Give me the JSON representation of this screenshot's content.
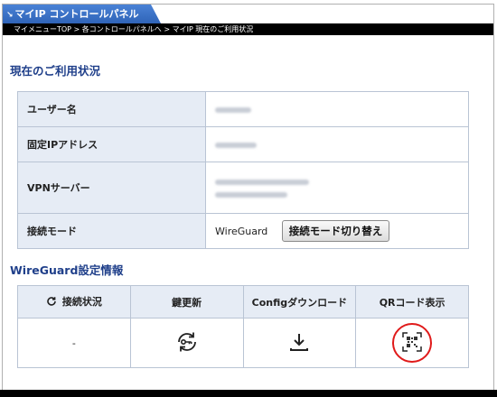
{
  "header": {
    "title": "マイIP コントロールパネル",
    "breadcrumb": "マイメニューTOP > 各コントロールパネルへ > マイIP 現在のご利用状況"
  },
  "usage": {
    "heading": "現在のご利用状況",
    "rows": {
      "username_label": "ユーザー名",
      "fixed_ip_label": "固定IPアドレス",
      "vpn_label": "VPNサーバー",
      "mode_label": "接続モード",
      "mode_value": "WireGuard",
      "mode_button": "接続モード切り替え"
    }
  },
  "wireguard": {
    "heading": "WireGuard設定情報",
    "columns": [
      "接続状況",
      "鍵更新",
      "Configダウンロード",
      "QRコード表示"
    ],
    "status_value": "-"
  },
  "colors": {
    "accent": "#1f3f8a",
    "tab": "#3a70c4",
    "highlight_circle": "#e01a1a"
  }
}
